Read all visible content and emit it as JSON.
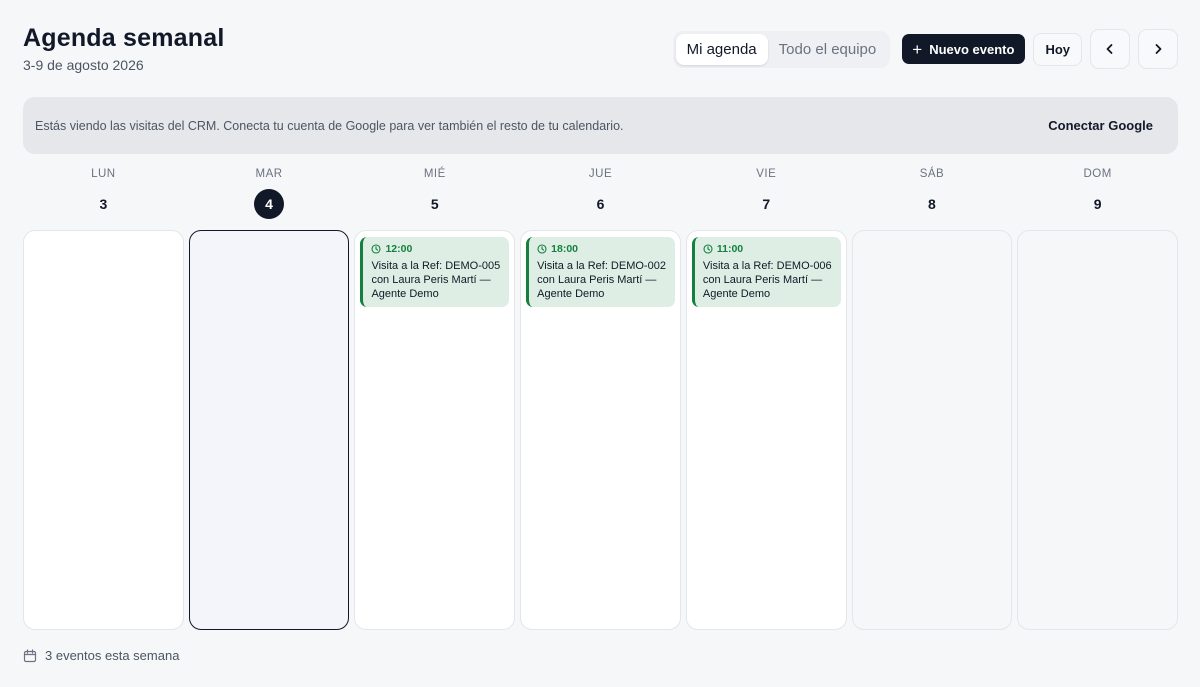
{
  "header": {
    "title": "Agenda semanal",
    "subtitle": "3-9 de agosto 2026"
  },
  "toolbar": {
    "tab_mine": "Mi agenda",
    "tab_team": "Todo el equipo",
    "new_event": "Nuevo evento",
    "today": "Hoy",
    "prev_icon": "chevron-left-icon",
    "next_icon": "chevron-right-icon"
  },
  "banner": {
    "text": "Estás viendo las visitas del CRM. Conecta tu cuenta de Google para ver también el resto de tu calendario.",
    "button": "Conectar Google"
  },
  "days": [
    {
      "name": "LUN",
      "num": "3",
      "today": false,
      "weekend": false
    },
    {
      "name": "MAR",
      "num": "4",
      "today": true,
      "weekend": false
    },
    {
      "name": "MIÉ",
      "num": "5",
      "today": false,
      "weekend": false
    },
    {
      "name": "JUE",
      "num": "6",
      "today": false,
      "weekend": false
    },
    {
      "name": "VIE",
      "num": "7",
      "today": false,
      "weekend": false
    },
    {
      "name": "SÁB",
      "num": "8",
      "today": false,
      "weekend": true
    },
    {
      "name": "DOM",
      "num": "9",
      "today": false,
      "weekend": true
    }
  ],
  "events": {
    "wed": {
      "time": "12:00",
      "title": "Visita a la Ref: DEMO-005 con Laura Peris Martí — Agente Demo"
    },
    "thu": {
      "time": "18:00",
      "title": "Visita a la Ref: DEMO-002 con Laura Peris Martí — Agente Demo"
    },
    "fri": {
      "time": "11:00",
      "title": "Visita a la Ref: DEMO-006 con Laura Peris Martí — Agente Demo"
    }
  },
  "footer": {
    "text": "3 eventos esta semana"
  },
  "colors": {
    "accent": "#111827",
    "event_bg": "#deeee4",
    "event_border": "#15803d"
  }
}
